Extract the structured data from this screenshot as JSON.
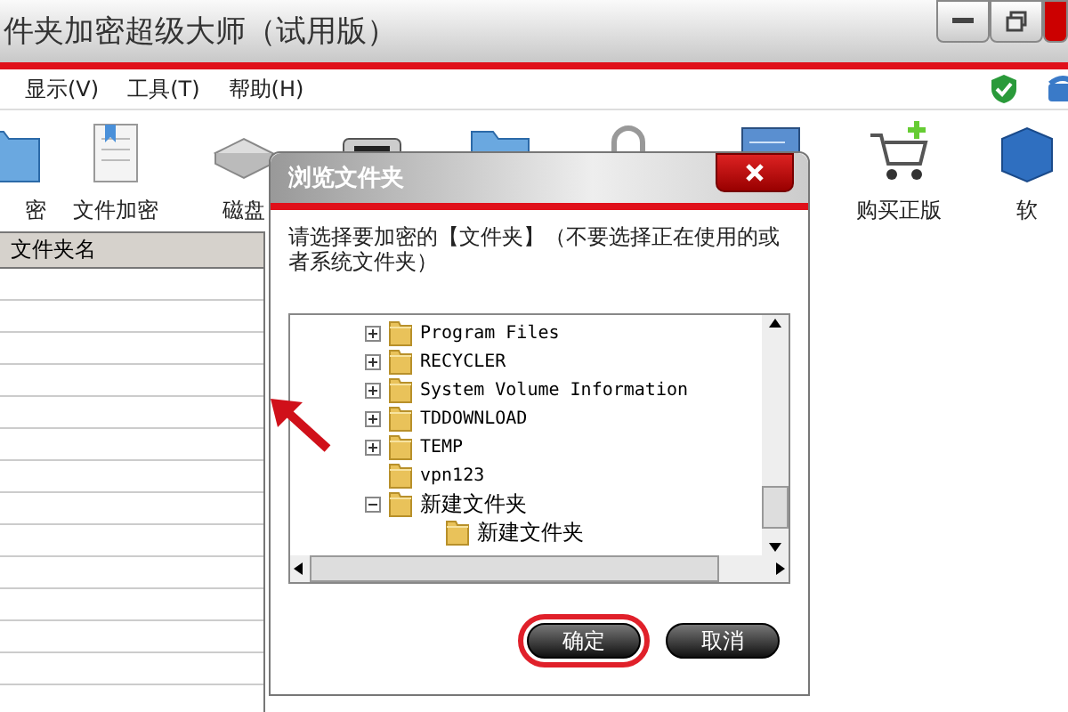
{
  "window": {
    "title": "件夹加密超级大师（试用版）"
  },
  "menu": [
    "显示(V)",
    "工具(T)",
    "帮助(H)"
  ],
  "toolbar": [
    {
      "kind": "folder",
      "label": "密"
    },
    {
      "kind": "document",
      "label": "文件加密"
    },
    {
      "kind": "drive",
      "label": "磁盘"
    },
    {
      "kind": "printer"
    },
    {
      "kind": "folder"
    },
    {
      "kind": "padlock"
    },
    {
      "kind": "monitor"
    },
    {
      "kind": "cart",
      "label": "购买正版"
    },
    {
      "kind": "cube",
      "label": "软"
    }
  ],
  "table": {
    "columns": [
      "文件夹名"
    ]
  },
  "dialog": {
    "title": "浏览文件夹",
    "message": "请选择要加密的【文件夹】（不要选择正在使用的或者系统文件夹）",
    "tree": [
      {
        "label": "Program Files",
        "kind": "collapsed"
      },
      {
        "label": "RECYCLER",
        "kind": "collapsed"
      },
      {
        "label": "System Volume Information",
        "kind": "collapsed"
      },
      {
        "label": "TDDOWNLOAD",
        "kind": "collapsed"
      },
      {
        "label": "TEMP",
        "kind": "collapsed"
      },
      {
        "label": "vpn123",
        "kind": "leaf"
      },
      {
        "label": "新建文件夹",
        "kind": "expanded",
        "children": [
          {
            "label": "新建文件夹",
            "kind": "leaf"
          }
        ]
      }
    ],
    "buttons": [
      {
        "label": "确定",
        "highlighted": true
      },
      {
        "label": "取消",
        "highlighted": false
      }
    ]
  }
}
